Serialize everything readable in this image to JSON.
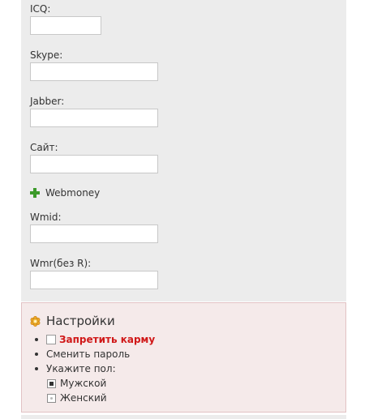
{
  "contact_fields": {
    "icq": {
      "label": "ICQ:",
      "value": ""
    },
    "skype": {
      "label": "Skype:",
      "value": ""
    },
    "jabber": {
      "label": "Jabber:",
      "value": ""
    },
    "site": {
      "label": "Сайт:",
      "value": ""
    }
  },
  "webmoney": {
    "title": "Webmoney",
    "icon": "plus-icon",
    "wmid": {
      "label": "Wmid:",
      "value": ""
    },
    "wmr": {
      "label": "Wmr(без R):",
      "value": ""
    }
  },
  "settings": {
    "title": "Настройки",
    "icon": "gear-icon",
    "forbid_karma": {
      "label": "Запретить карму",
      "checked": false
    },
    "change_password": "Сменить пароль",
    "gender": {
      "label": "Укажите пол:",
      "options": [
        {
          "label": "Мужской",
          "selected": true
        },
        {
          "label": "Женский",
          "selected": false
        }
      ]
    }
  },
  "colors": {
    "panel_bg": "#ececec",
    "settings_bg": "#f5eaea",
    "settings_border": "#e2c2c4",
    "karma_red": "#d01818",
    "plus_green": "#3c9a2a"
  }
}
